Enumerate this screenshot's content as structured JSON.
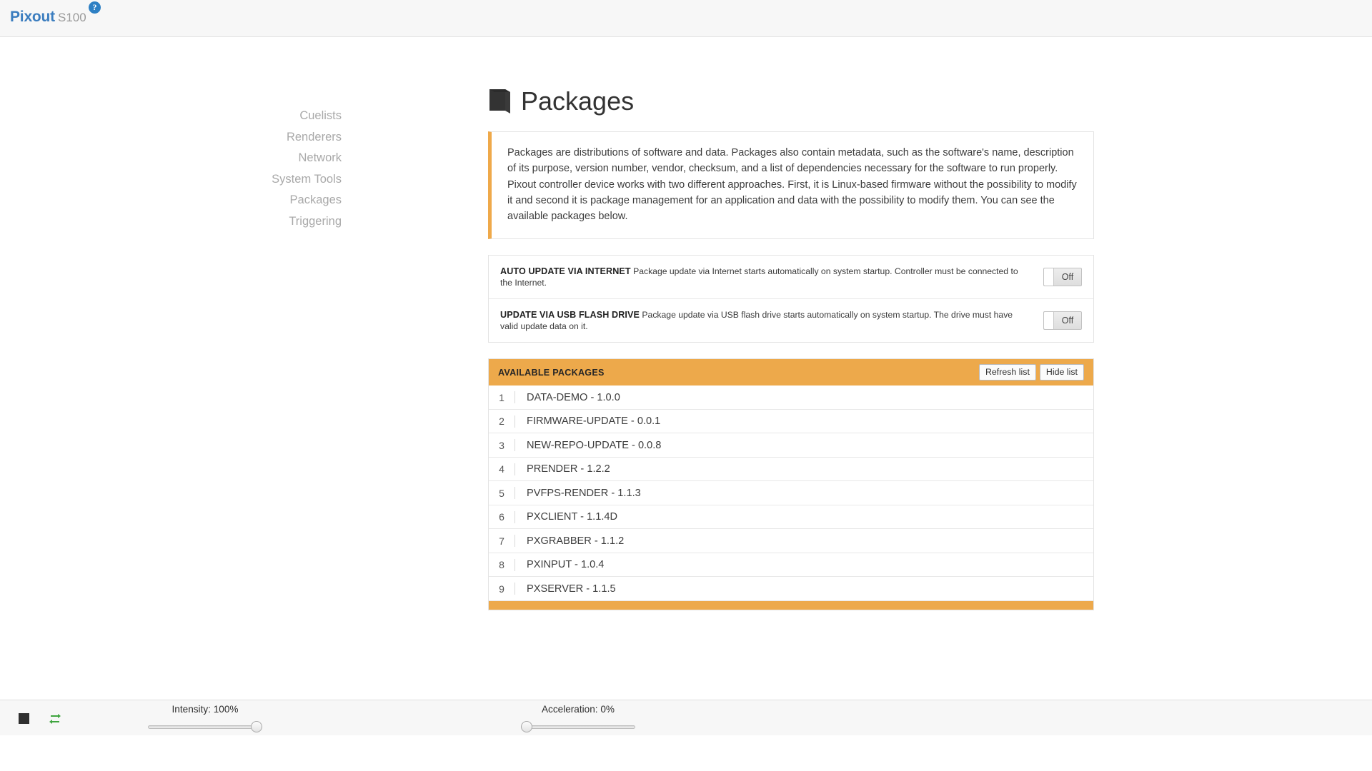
{
  "header": {
    "brand_name": "Pixout",
    "brand_model": "S100",
    "help_icon": "help-circle-icon",
    "help_glyph": "?"
  },
  "sidebar": {
    "items": [
      {
        "label": "Cuelists",
        "name": "cuelists"
      },
      {
        "label": "Renderers",
        "name": "renderers"
      },
      {
        "label": "Network",
        "name": "network"
      },
      {
        "label": "System Tools",
        "name": "system-tools"
      },
      {
        "label": "Packages",
        "name": "packages"
      },
      {
        "label": "Triggering",
        "name": "triggering"
      }
    ]
  },
  "main": {
    "title": "Packages",
    "title_icon": "package-book-icon",
    "description": "Packages are distributions of software and data. Packages also contain metadata, such as the software's name, description of its purpose, version number, vendor, checksum, and a list of dependencies necessary for the software to run properly. Pixout controller device works with two different approaches. First, it is Linux-based firmware without the possibility to modify it and second it is package management for an application and data with the possibility to modify them. You can see the available packages below.",
    "settings": [
      {
        "title": "AUTO UPDATE VIA INTERNET",
        "description": "Package update via Internet starts automatically on system startup. Controller must be connected to the Internet.",
        "state": "Off",
        "name": "auto-update-via-internet"
      },
      {
        "title": "UPDATE VIA USB FLASH DRIVE",
        "description": "Package update via USB flash drive starts automatically on system startup. The drive must have valid update data on it.",
        "state": "Off",
        "name": "update-via-usb-flash-drive"
      }
    ],
    "packages_panel": {
      "heading": "AVAILABLE PACKAGES",
      "refresh_label": "Refresh list",
      "hide_label": "Hide list",
      "rows": [
        {
          "index": "1",
          "name": "DATA-DEMO - 1.0.0"
        },
        {
          "index": "2",
          "name": "FIRMWARE-UPDATE - 0.0.1"
        },
        {
          "index": "3",
          "name": "NEW-REPO-UPDATE - 0.0.8"
        },
        {
          "index": "4",
          "name": "PRENDER - 1.2.2"
        },
        {
          "index": "5",
          "name": "PVFPS-RENDER - 1.1.3"
        },
        {
          "index": "6",
          "name": "PXCLIENT - 1.1.4D"
        },
        {
          "index": "7",
          "name": "PXGRABBER - 1.1.2"
        },
        {
          "index": "8",
          "name": "PXINPUT - 1.0.4"
        },
        {
          "index": "9",
          "name": "PXSERVER - 1.1.5"
        }
      ]
    }
  },
  "statusbar": {
    "blackout_icon": "blackout-square-icon",
    "sync_icon": "transfer-arrows-icon",
    "intensity": {
      "label": "Intensity: 100%",
      "percent": 100
    },
    "acceleration": {
      "label": "Acceleration: 0%",
      "percent": 0
    }
  },
  "colors": {
    "accent_orange": "#eda94b",
    "brand_blue": "#3b7dbf",
    "help_blue": "#2e80c4",
    "sync_green": "#4caf50"
  }
}
